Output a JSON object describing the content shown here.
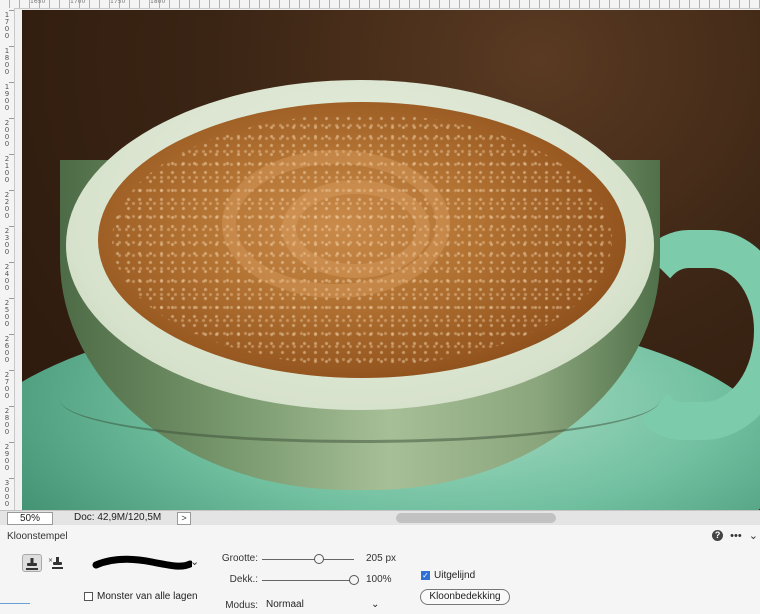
{
  "ruler_top": {
    "labels": [
      "1650",
      "1700",
      "1750",
      "1800"
    ]
  },
  "ruler_left": {
    "labels": [
      "1700",
      "1800",
      "1900",
      "2000",
      "2100",
      "2200",
      "2300",
      "2400",
      "2500",
      "2600",
      "2700",
      "2800",
      "2900",
      "3000"
    ]
  },
  "status": {
    "zoom": "50%",
    "doc_info": "Doc: 42,9M/120,5M",
    "arrow": ">"
  },
  "tool_options": {
    "title": "Kloonstempel",
    "help_icon": "?",
    "more_icon": "•••",
    "size": {
      "label": "Grootte:",
      "value": "205 px",
      "level": 0.62
    },
    "opacity": {
      "label": "Dekk.:",
      "value": "100%",
      "level": 1.0
    },
    "mode": {
      "label": "Modus:",
      "value": "Normaal"
    },
    "aligned": {
      "label": "Uitgelijnd",
      "checked": true
    },
    "sample_all_layers": {
      "label": "Monster van alle lagen",
      "checked": false
    },
    "clone_overlay_button": "Kloonbedekking"
  },
  "icons": {
    "clone_stamp": "clone-stamp-icon",
    "pattern_stamp": "pattern-stamp-icon",
    "help": "help-icon",
    "more": "more-icon"
  },
  "colors": {
    "accent": "#2f6fd6",
    "panel_bg": "#f5f5f5"
  }
}
